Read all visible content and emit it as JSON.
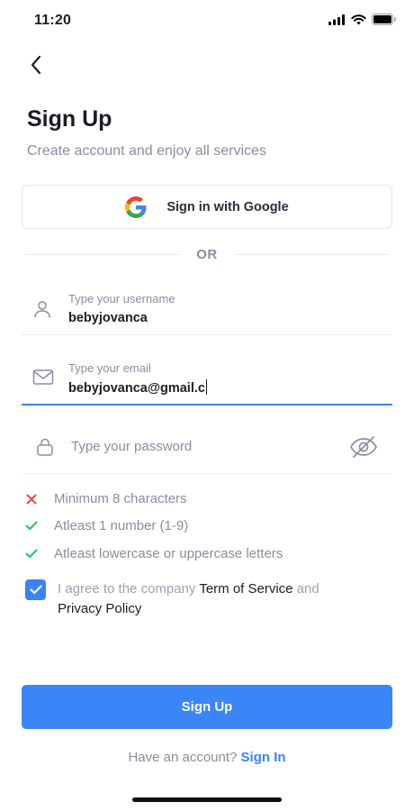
{
  "status_bar": {
    "time": "11:20",
    "icons": [
      "signal-icon",
      "wifi-icon",
      "battery-icon"
    ]
  },
  "header": {
    "back_icon": "chevron-left-icon",
    "title": "Sign Up",
    "subtitle": "Create account and enjoy all services"
  },
  "google": {
    "label": "Sign in with Google",
    "icon": "google-logo-icon"
  },
  "divider": {
    "text": "OR"
  },
  "fields": {
    "username": {
      "label": "Type your username",
      "value": "bebyjovanca",
      "icon": "user-icon"
    },
    "email": {
      "label": "Type your email",
      "value": "bebyjovanca@gmail.c",
      "icon": "mail-icon",
      "focused": true
    },
    "password": {
      "placeholder": "Type your password",
      "icon": "lock-icon",
      "toggle_icon": "eye-off-icon"
    }
  },
  "password_rules": [
    {
      "text": "Minimum 8 characters",
      "status": "fail"
    },
    {
      "text": "Atleast 1 number (1-9)",
      "status": "pass"
    },
    {
      "text": "Atleast lowercase or uppercase letters",
      "status": "pass"
    }
  ],
  "agreement": {
    "checked": true,
    "prefix": "I agree to the company ",
    "terms_link": "Term of Service",
    "middle": " and",
    "privacy_link": "Privacy Policy"
  },
  "signup_button": {
    "label": "Sign Up"
  },
  "footer": {
    "prompt": "Have an account? ",
    "signin_link": "Sign In"
  },
  "colors": {
    "primary": "#3b86f7",
    "text": "#1c1c28",
    "muted": "#8c8ca1",
    "fail": "#ef4444",
    "pass": "#22c55e"
  }
}
